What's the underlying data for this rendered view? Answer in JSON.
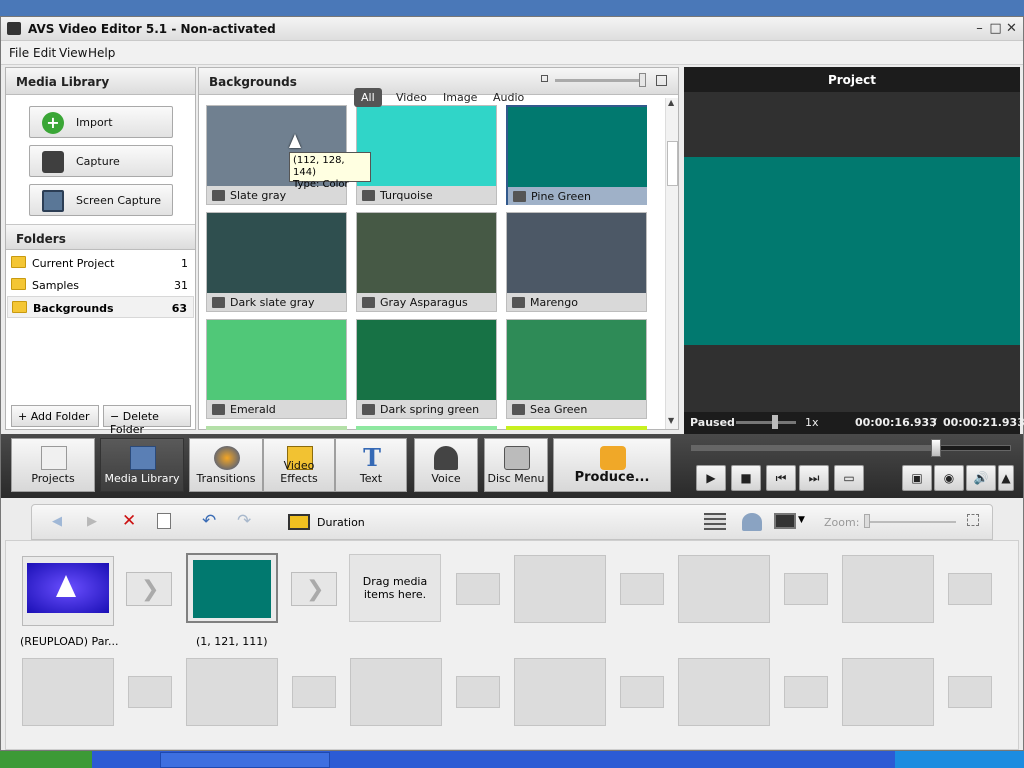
{
  "window": {
    "title": "AVS Video Editor 5.1 - Non-activated"
  },
  "menu": [
    "File",
    "Edit",
    "View",
    "Help"
  ],
  "media_library": {
    "header": "Media Library",
    "buttons": [
      "Import",
      "Capture",
      "Screen Capture"
    ],
    "folders_header": "Folders",
    "folders": [
      {
        "name": "Current Project",
        "count": "1"
      },
      {
        "name": "Samples",
        "count": "31"
      },
      {
        "name": "Backgrounds",
        "count": "63"
      }
    ],
    "add_folder": "Add Folder",
    "delete_folder": "Delete Folder"
  },
  "backgrounds": {
    "header": "Backgrounds",
    "tabs": [
      "All",
      "Video",
      "Image",
      "Audio"
    ],
    "tooltip_line1": "(112, 128, 144)",
    "tooltip_line2": "Type: Color",
    "tiles": [
      {
        "label": "Slate gray",
        "color": "#708090"
      },
      {
        "label": "Turquoise",
        "color": "#30d5c8"
      },
      {
        "label": "Pine Green",
        "color": "#01796f"
      },
      {
        "label": "Dark slate gray",
        "color": "#2f4f4f"
      },
      {
        "label": "Gray Asparagus",
        "color": "#465945"
      },
      {
        "label": "Marengo",
        "color": "#4c5866"
      },
      {
        "label": "Emerald",
        "color": "#50c878"
      },
      {
        "label": "Dark spring green",
        "color": "#177245"
      },
      {
        "label": "Sea Green",
        "color": "#2e8b57"
      }
    ]
  },
  "preview": {
    "header": "Project",
    "status": "Paused",
    "speed": "1x",
    "time_current": "00:00:16.933",
    "time_separator": "/",
    "time_total": "00:00:21.933",
    "preview_color": "#01796f",
    "progress_fraction": 0.77
  },
  "toolbar": [
    "Projects",
    "Media Library",
    "Transitions",
    "Video Effects",
    "Text",
    "Voice",
    "Disc Menu",
    "Produce..."
  ],
  "timeline": {
    "duration_label": "Duration",
    "zoom_label": "Zoom:",
    "item1_label": "(REUPLOAD) Par...",
    "item2_label": "(1, 121, 111)",
    "item2_color": "#01796f",
    "drop_text": "Drag media items here."
  }
}
